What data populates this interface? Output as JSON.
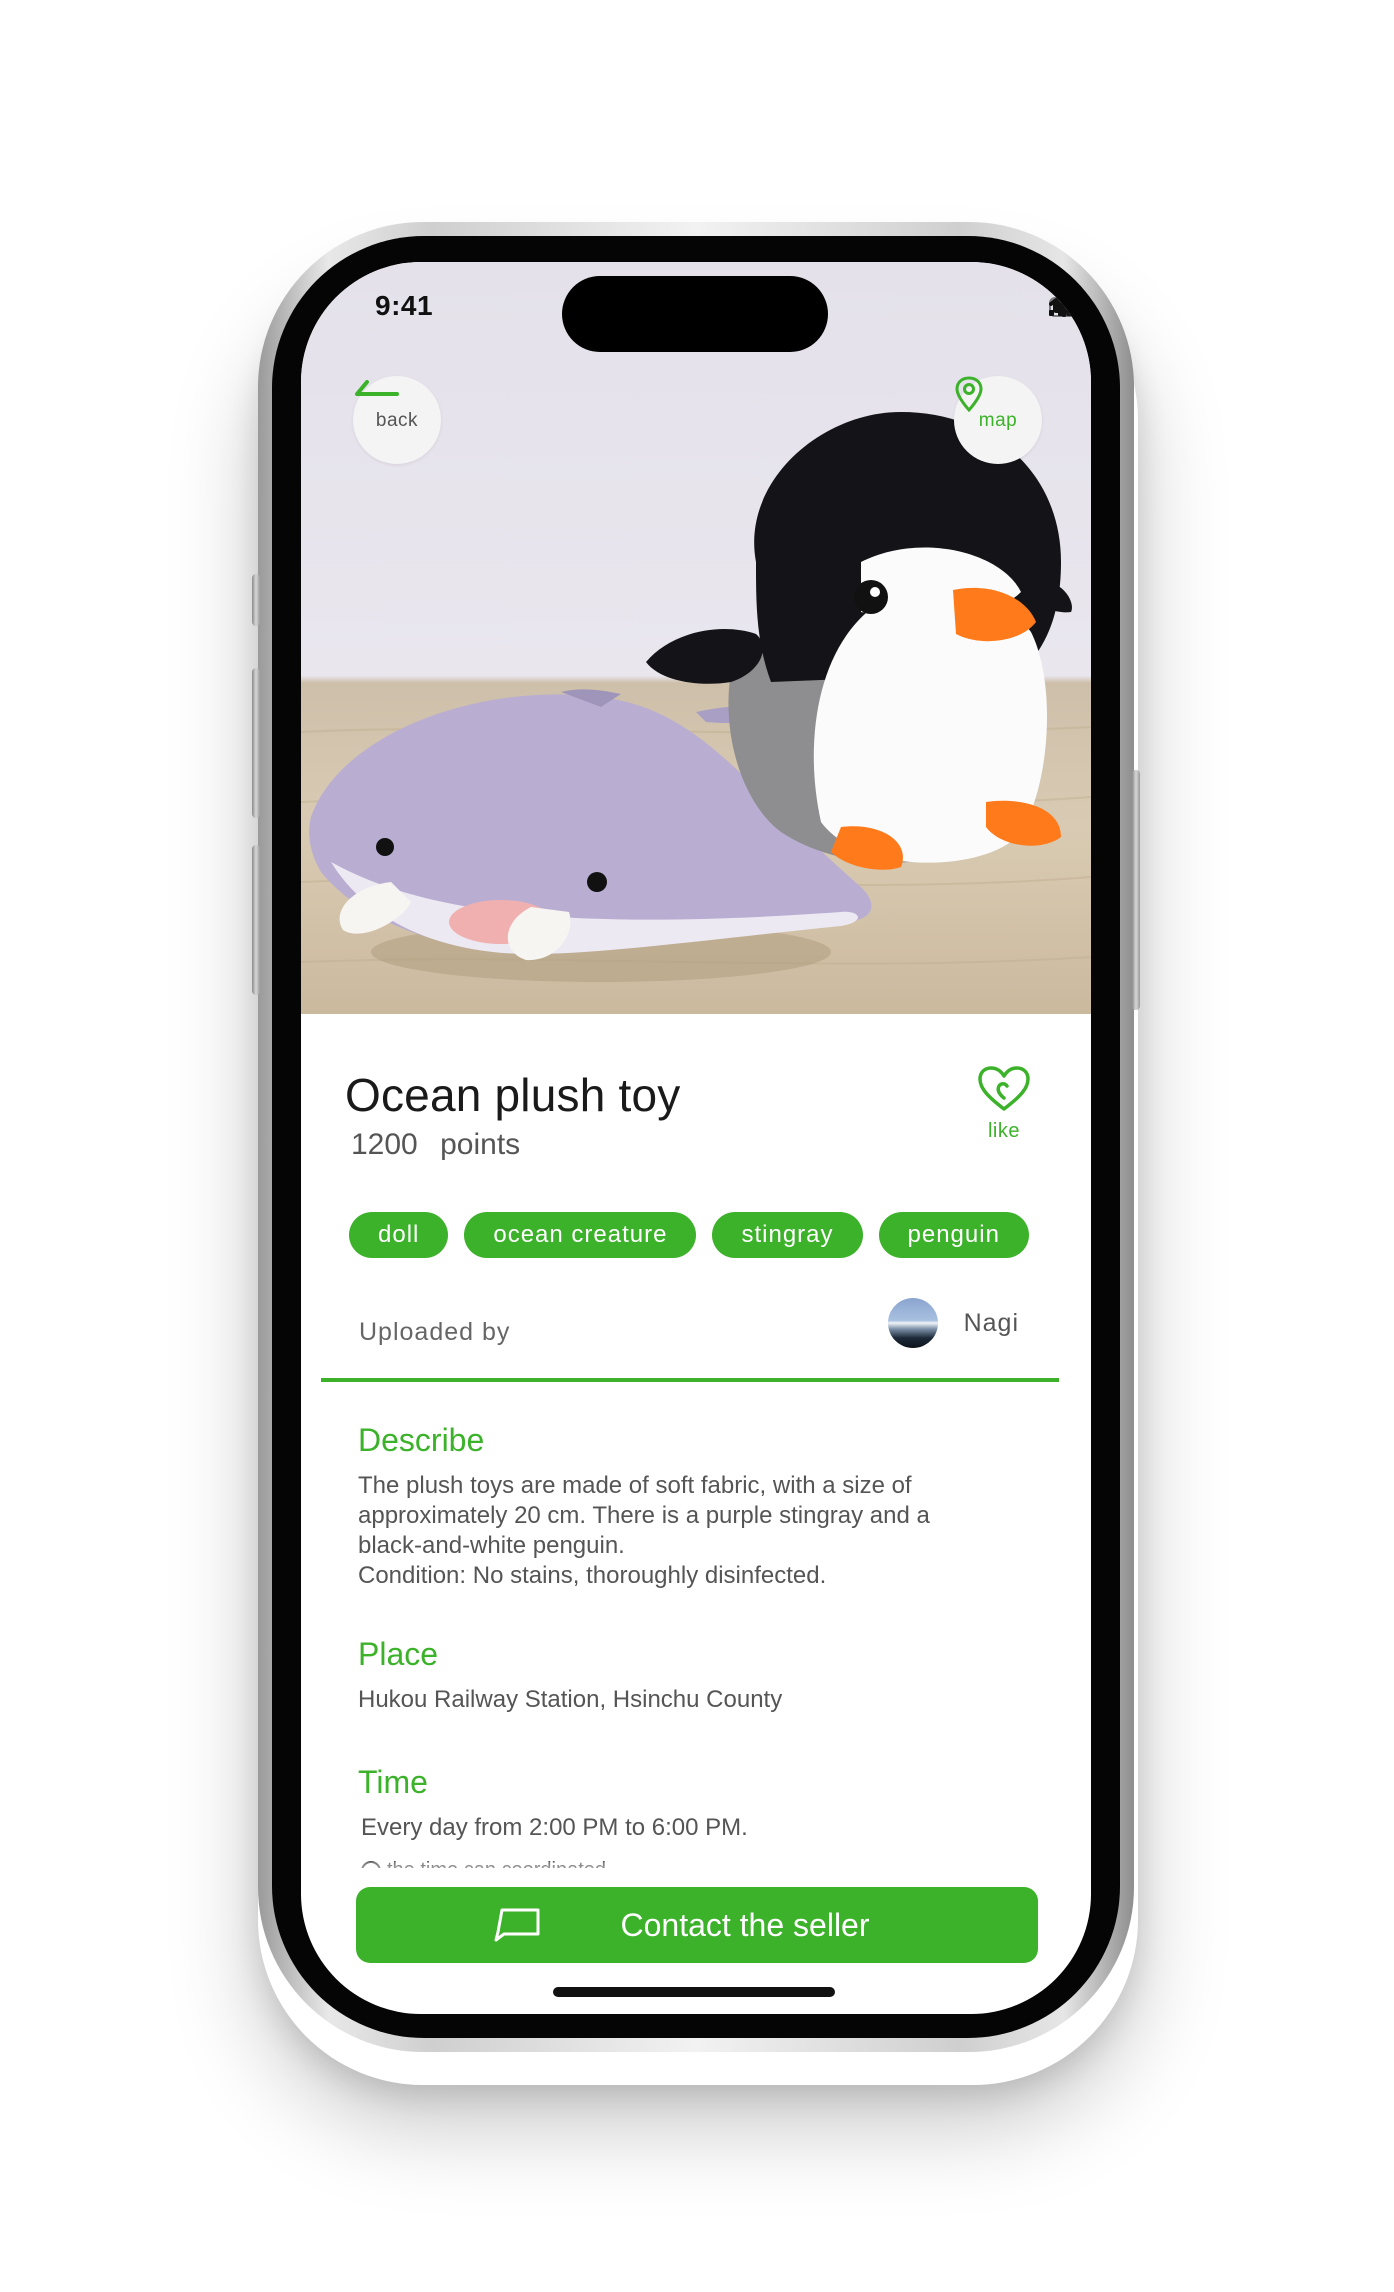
{
  "status_bar": {
    "time": "9:41"
  },
  "header": {
    "back_label": "back",
    "map_label": "map"
  },
  "product": {
    "title": "Ocean plush toy",
    "points_value": "1200",
    "points_unit": "points",
    "like_label": "like",
    "tags": [
      "doll",
      "ocean creature",
      "stingray",
      "penguin"
    ]
  },
  "uploader": {
    "label": "Uploaded by",
    "name": "Nagi"
  },
  "describe": {
    "heading": "Describe",
    "lines": [
      "The plush toys are made of soft fabric, with a size of",
      "approximately 20 cm. There is a purple stingray and a",
      "black-and-white penguin.",
      "Condition: No stains, thoroughly disinfected."
    ]
  },
  "place": {
    "heading": "Place",
    "text": "Hukou Railway Station, Hsinchu County"
  },
  "time": {
    "heading": "Time",
    "text": "Every day from 2:00 PM to 6:00 PM.",
    "note": "the time can coordinated"
  },
  "cta": {
    "label": "Contact the seller"
  },
  "colors": {
    "accent": "#3cb22a",
    "text": "#1a1a1a",
    "muted": "#555555"
  },
  "icons": [
    "back-arrow-icon",
    "map-pin-icon",
    "heart-icon",
    "chat-icon",
    "signal-icon",
    "wifi-icon",
    "battery-icon"
  ]
}
